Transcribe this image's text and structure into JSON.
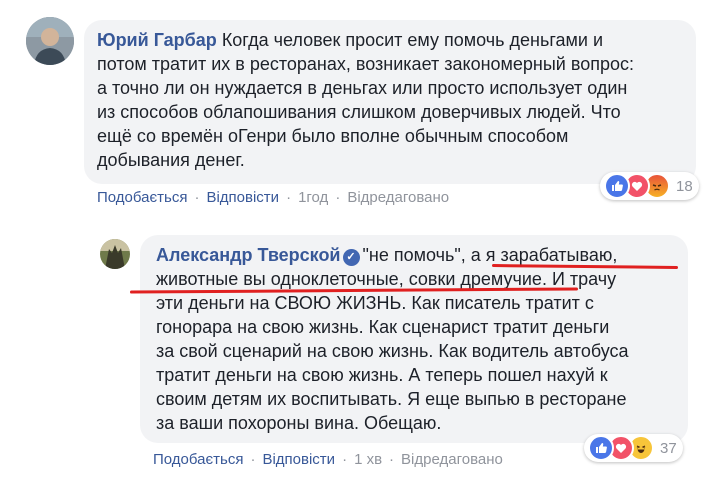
{
  "comment1": {
    "author": "Юрий Гарбар",
    "lines": [
      "Когда человек просит ему помочь деньгами и",
      "потом тратит их в ресторанах, возникает закономерный вопрос:",
      "а точно ли он нуждается в деньгах или просто использует один",
      "из способов облапошивания слишком доверчивых людей. Что",
      "ещё со времён оГенри было вполне обычным способом",
      "добывания денег."
    ],
    "actions": {
      "like": "Подобається",
      "reply": "Відповісти",
      "time": "1год",
      "edited": "Відредаговано"
    },
    "reaction_count": "18",
    "reaction_icons": [
      "like-icon",
      "love-icon",
      "angry-icon"
    ]
  },
  "comment2": {
    "author": "Александр Тверской",
    "line1_prefix": "\"не помочь\", ",
    "line1_underlined": "а я зарабатываю,",
    "line2_underlined": "животные вы одноклеточные, совки дремучие",
    "line2_suffix": ". И трачу",
    "lines": [
      "эти деньги на СВОЮ ЖИЗНЬ. Как писатель тратит с",
      "гонорара на свою жизнь. Как сценарист тратит деньги",
      "за свой сценарий на свою жизнь. Как водитель автобуса",
      "тратит деньги на свою жизнь. А теперь пошел нахуй к",
      "своим детям их воспитывать. Я еще выпью в ресторане",
      "за ваши похороны вина. Обещаю."
    ],
    "actions": {
      "like": "Подобається",
      "reply": "Відповісти",
      "time": "1 хв",
      "edited": "Відредаговано"
    },
    "reaction_count": "37",
    "reaction_icons": [
      "like-icon",
      "love-icon",
      "haha-icon"
    ]
  },
  "colors": {
    "link": "#385898",
    "muted": "#90949c",
    "bubble": "#f2f3f5",
    "underline": "#e02020"
  }
}
